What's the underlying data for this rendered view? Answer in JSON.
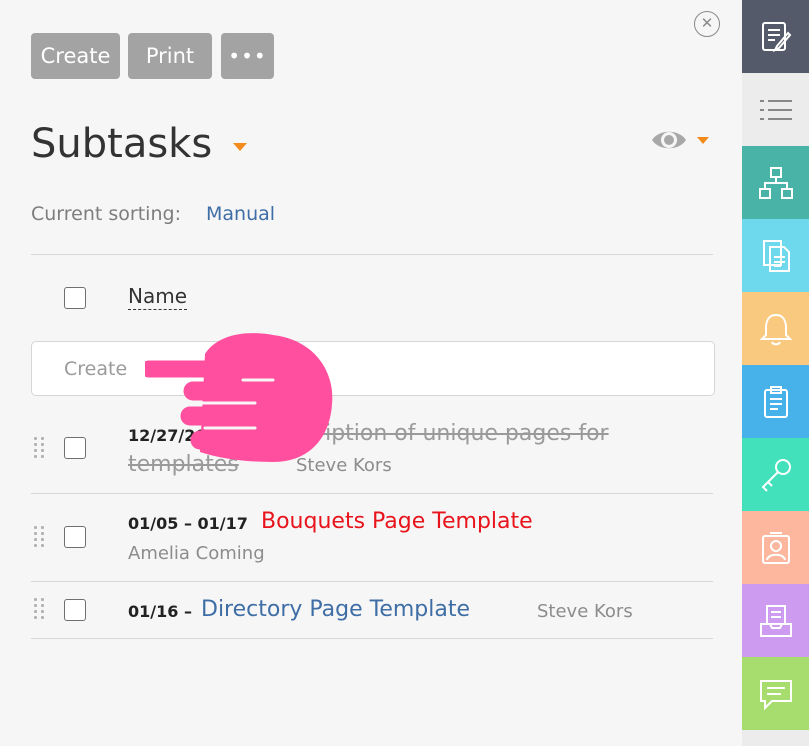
{
  "toolbar": {
    "create_label": "Create",
    "print_label": "Print",
    "more_label": "•••",
    "close_label": "✕"
  },
  "header": {
    "title": "Subtasks",
    "sorting_label": "Current sorting:",
    "sorting_value": "Manual"
  },
  "table": {
    "name_column": "Name",
    "create_placeholder": "Create"
  },
  "rows": [
    {
      "date": "12/27/2019 –",
      "title_line1": "Description of unique pages for",
      "title_line2": "templates",
      "assignee": "Steve Kors",
      "status": "completed"
    },
    {
      "date": "01/05 – 01/17",
      "title": "Bouquets Page Template",
      "assignee": "Amelia Coming",
      "status": "overdue"
    },
    {
      "date": "01/16 –",
      "title": "Directory Page Template",
      "assignee": "Steve Kors",
      "status": "open"
    }
  ],
  "colors": {
    "accent_orange": "#f28a1c",
    "link_blue": "#3f6ea6",
    "overdue_red": "#e8141c",
    "button_gray": "#a3a3a3",
    "pointer_pink": "#ff4f9e"
  },
  "rail": [
    {
      "icon": "edit-note-icon",
      "color": "#555a6b"
    },
    {
      "icon": "list-icon",
      "color": "#ececec"
    },
    {
      "icon": "hierarchy-icon",
      "color": "#48b3a6"
    },
    {
      "icon": "documents-icon",
      "color": "#6ed8ec"
    },
    {
      "icon": "bell-icon",
      "color": "#f9c97f"
    },
    {
      "icon": "clipboard-icon",
      "color": "#47b2ea"
    },
    {
      "icon": "key-icon",
      "color": "#43e0bc"
    },
    {
      "icon": "contact-card-icon",
      "color": "#fdb79e"
    },
    {
      "icon": "inbox-tray-icon",
      "color": "#cd9cf0"
    },
    {
      "icon": "chat-bubble-icon",
      "color": "#a6dd6e"
    }
  ]
}
